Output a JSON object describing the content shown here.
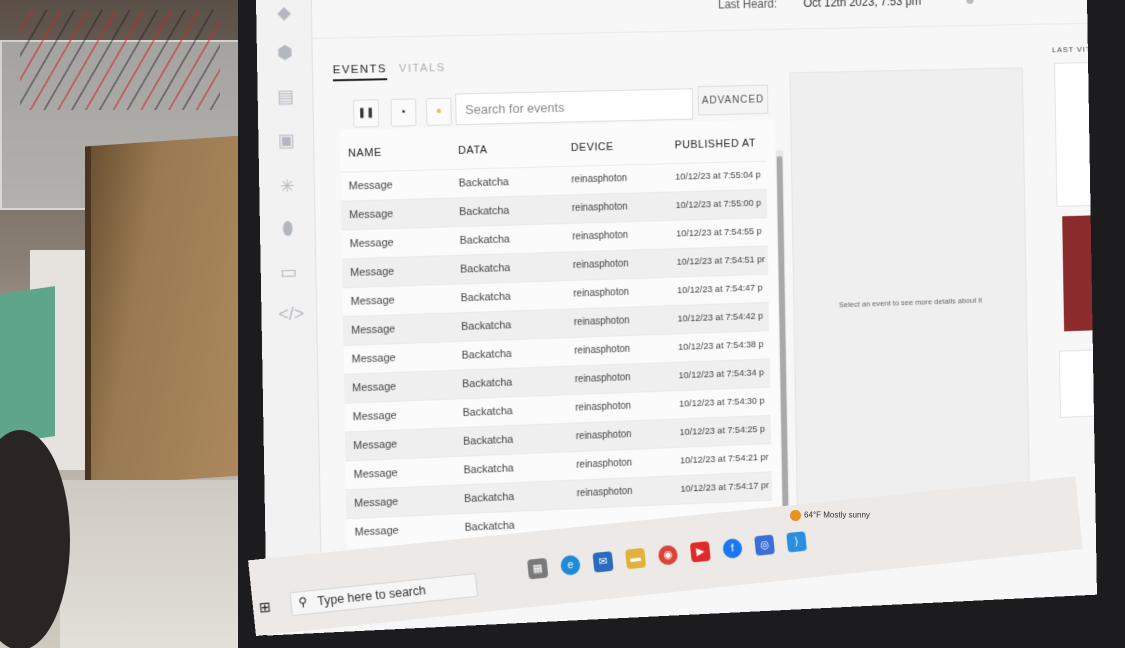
{
  "header": {
    "last_heard_label": "Last Heard:",
    "last_heard_value": "Oct 12th 2023, 7:53 pm"
  },
  "tabs": [
    {
      "label": "EVENTS",
      "active": true
    },
    {
      "label": "VITALS",
      "active": false
    }
  ],
  "toolbar": {
    "search_placeholder": "Search for events",
    "advanced_label": "ADVANCED"
  },
  "table": {
    "columns": [
      "NAME",
      "DATA",
      "DEVICE",
      "PUBLISHED AT"
    ],
    "rows": [
      {
        "name": "Message",
        "data": "Backatcha",
        "device": "reinasphoton",
        "published": "10/12/23 at 7:55:04 p"
      },
      {
        "name": "Message",
        "data": "Backatcha",
        "device": "reinasphoton",
        "published": "10/12/23 at 7:55:00 p"
      },
      {
        "name": "Message",
        "data": "Backatcha",
        "device": "reinasphoton",
        "published": "10/12/23 at 7:54:55 p"
      },
      {
        "name": "Message",
        "data": "Backatcha",
        "device": "reinasphoton",
        "published": "10/12/23 at 7:54:51 pr"
      },
      {
        "name": "Message",
        "data": "Backatcha",
        "device": "reinasphoton",
        "published": "10/12/23 at 7:54:47 p"
      },
      {
        "name": "Message",
        "data": "Backatcha",
        "device": "reinasphoton",
        "published": "10/12/23 at 7:54:42 p"
      },
      {
        "name": "Message",
        "data": "Backatcha",
        "device": "reinasphoton",
        "published": "10/12/23 at 7:54:38 p"
      },
      {
        "name": "Message",
        "data": "Backatcha",
        "device": "reinasphoton",
        "published": "10/12/23 at 7:54:34 p"
      },
      {
        "name": "Message",
        "data": "Backatcha",
        "device": "reinasphoton",
        "published": "10/12/23 at 7:54:30 p"
      },
      {
        "name": "Message",
        "data": "Backatcha",
        "device": "reinasphoton",
        "published": "10/12/23 at 7:54:25 p"
      },
      {
        "name": "Message",
        "data": "Backatcha",
        "device": "reinasphoton",
        "published": "10/12/23 at 7:54:21 pr"
      },
      {
        "name": "Message",
        "data": "Backatcha",
        "device": "reinasphoton",
        "published": "10/12/23 at 7:54:17 pr"
      },
      {
        "name": "Message",
        "data": "Backatcha",
        "device": "",
        "published": ""
      }
    ]
  },
  "detail": {
    "empty_text": "Select an event to see more details about it"
  },
  "right_panel": {
    "title": "LAST VIT"
  },
  "taskbar": {
    "search_text": "Type here to search",
    "weather": "64°F Mostly sunny"
  }
}
